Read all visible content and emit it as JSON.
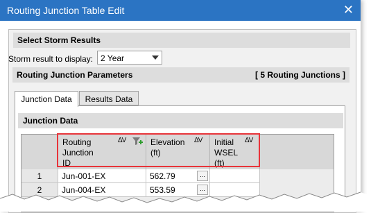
{
  "window": {
    "title": "Routing Junction Table Edit",
    "close_icon": "close-icon"
  },
  "storm": {
    "section_title": "Select Storm Results",
    "label": "Storm result to display:",
    "selected": "2 Year"
  },
  "params": {
    "section_title": "Routing Junction Parameters",
    "count_label": "[ 5 Routing Junctions ]"
  },
  "tabs": [
    {
      "label": "Junction Data",
      "active": true
    },
    {
      "label": "Results Data",
      "active": false
    }
  ],
  "panel": {
    "title": "Junction Data"
  },
  "table": {
    "columns": [
      {
        "label": "Routing Junction ID",
        "lines": [
          "Routing",
          "Junction",
          "ID"
        ],
        "has_filter": true
      },
      {
        "label": "Elevation (ft)",
        "lines": [
          "Elevation",
          "(ft)"
        ],
        "has_filter": false
      },
      {
        "label": "Initial WSEL (ft)",
        "lines": [
          "Initial",
          "WSEL",
          "(ft)"
        ],
        "has_filter": false
      }
    ],
    "sort_glyph": "ΔV",
    "rows": [
      {
        "num": "1",
        "id": "Jun-001-EX",
        "elevation": "562.79",
        "wsel": ""
      },
      {
        "num": "2",
        "id": "Jun-004-EX",
        "elevation": "553.59",
        "wsel": ""
      }
    ],
    "ellipsis": "..."
  }
}
